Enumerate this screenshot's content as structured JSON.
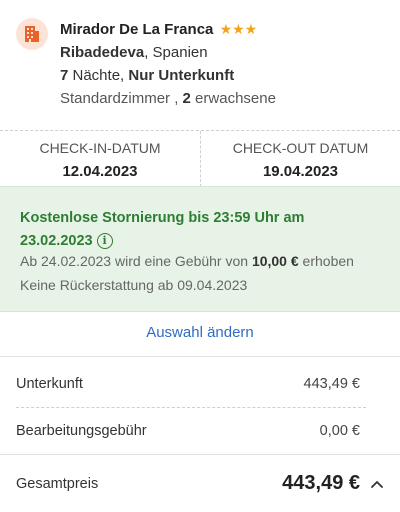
{
  "hotel": {
    "icon": "hotel-building-icon",
    "name": "Mirador De La Franca",
    "stars": "★★★",
    "star_count": 3,
    "star_color": "#f2a31b",
    "city": "Ribadedeva",
    "country": ", Spanien",
    "nights_count": "7",
    "nights_label": " Nächte, ",
    "board": "Nur Unterkunft",
    "room_type": "Standardzimmer , ",
    "guests_count": "2",
    "guests_label": " erwachsene"
  },
  "dates": {
    "checkin_label": "CHECK-IN-DATUM",
    "checkin_value": "12.04.2023",
    "checkout_label": "CHECK-OUT DATUM",
    "checkout_value": "19.04.2023"
  },
  "cancellation": {
    "title": "Kostenlose Stornierung bis 23:59 Uhr am 23.02.2023",
    "info_icon": "info-icon",
    "fee_prefix": "Ab 24.02.2023 wird eine Gebühr von ",
    "fee_amount": "10,00 €",
    "fee_suffix": " erhoben",
    "no_refund": "Keine Rückerstattung ab 09.04.2023",
    "accent_color": "#2e7d32",
    "background_color": "#e8f3e8"
  },
  "actions": {
    "change_selection": "Auswahl ändern",
    "link_color": "#2f6cc4"
  },
  "price": {
    "lines": [
      {
        "label": "Unterkunft",
        "value": "443,49 €"
      },
      {
        "label": "Bearbeitungsgebühr",
        "value": "0,00 €"
      }
    ],
    "total_label": "Gesamtpreis",
    "total_value": "443,49 €",
    "toggle_icon": "chevron-up-icon"
  }
}
